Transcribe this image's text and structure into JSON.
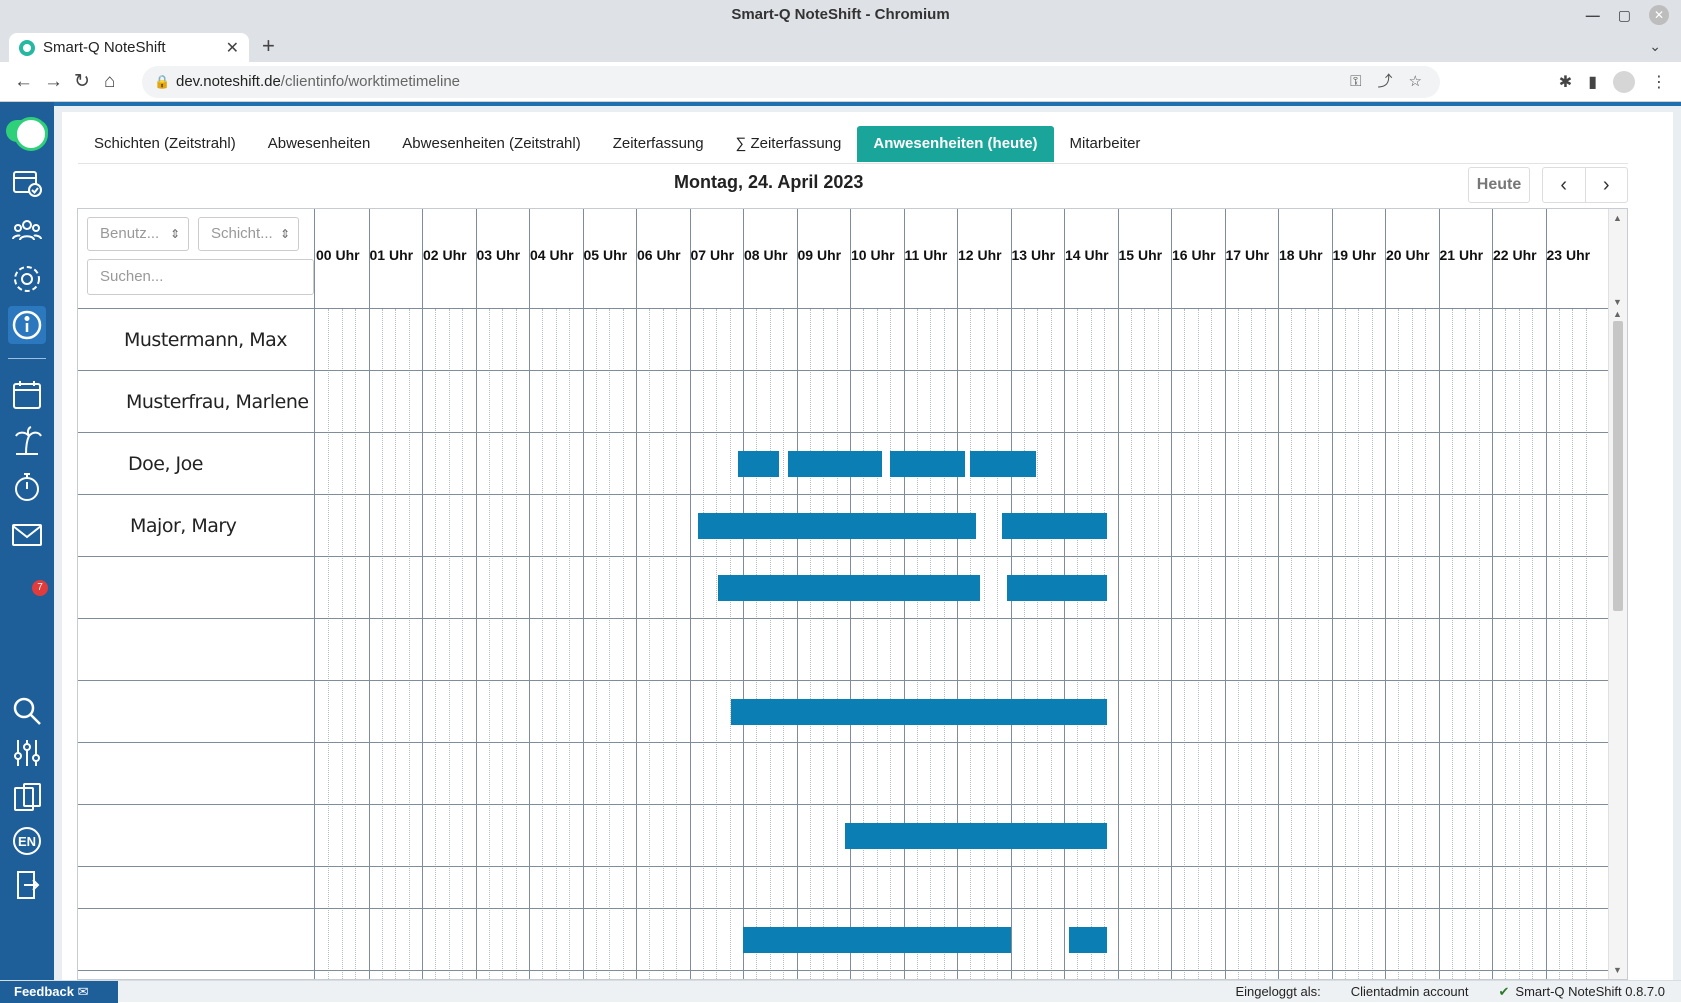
{
  "window": {
    "title": "Smart-Q NoteShift - Chromium"
  },
  "browser": {
    "tab_title": "Smart-Q NoteShift",
    "url_host": "dev.noteshift.de",
    "url_path": "/clientinfo/worktimetimeline"
  },
  "tabs": [
    {
      "label": "Schichten (Zeitstrahl)"
    },
    {
      "label": "Abwesenheiten"
    },
    {
      "label": "Abwesenheiten (Zeitstrahl)"
    },
    {
      "label": "Zeiterfassung"
    },
    {
      "label": "∑ Zeiterfassung"
    },
    {
      "label": "Anwesenheiten (heute)",
      "active": true
    },
    {
      "label": "Mitarbeiter"
    }
  ],
  "date_title": "Montag, 24. April 2023",
  "today_label": "Heute",
  "filters": {
    "user_placeholder": "Benutz...",
    "shift_placeholder": "Schicht...",
    "search_placeholder": "Suchen..."
  },
  "hours": [
    "00 Uhr",
    "01 Uhr",
    "02 Uhr",
    "03 Uhr",
    "04 Uhr",
    "05 Uhr",
    "06 Uhr",
    "07 Uhr",
    "08 Uhr",
    "09 Uhr",
    "10 Uhr",
    "11 Uhr",
    "12 Uhr",
    "13 Uhr",
    "14 Uhr",
    "15 Uhr",
    "16 Uhr",
    "17 Uhr",
    "18 Uhr",
    "19 Uhr",
    "20 Uhr",
    "21 Uhr",
    "22 Uhr",
    "23 Uhr"
  ],
  "rows": [
    {
      "name": "Mustermann, Max",
      "segments": []
    },
    {
      "name": "Musterfrau, Marlene",
      "segments": []
    },
    {
      "name": "Doe, Joe",
      "segments": [
        [
          7.9,
          8.67
        ],
        [
          8.85,
          10.6
        ],
        [
          10.75,
          12.15
        ],
        [
          12.25,
          13.47
        ]
      ]
    },
    {
      "name": "Major, Mary",
      "segments": [
        [
          7.15,
          12.35
        ],
        [
          12.85,
          14.8
        ]
      ]
    },
    {
      "name": "",
      "segments": [
        [
          7.53,
          12.43
        ],
        [
          12.93,
          14.8
        ]
      ]
    },
    {
      "name": "",
      "segments": []
    },
    {
      "name": "",
      "segments": [
        [
          7.78,
          14.8
        ]
      ]
    },
    {
      "name": "",
      "segments": []
    },
    {
      "name": "",
      "segments": [
        [
          9.9,
          14.8
        ]
      ]
    },
    {
      "name": "",
      "segments": []
    },
    {
      "name": "",
      "segments": [
        [
          8.0,
          13.0
        ],
        [
          14.1,
          14.8
        ]
      ]
    }
  ],
  "footer": {
    "feedback": "Feedback",
    "logged_in_label": "Eingeloggt als:",
    "account": "Clientadmin account",
    "version": "Smart-Q NoteShift 0.8.7.0"
  },
  "sidebar": {
    "mail_badge": "7",
    "language": "EN"
  },
  "colors": {
    "accent": "#1aa59a",
    "sidebar": "#1e5f9a",
    "bar": "#0b7fb3"
  }
}
